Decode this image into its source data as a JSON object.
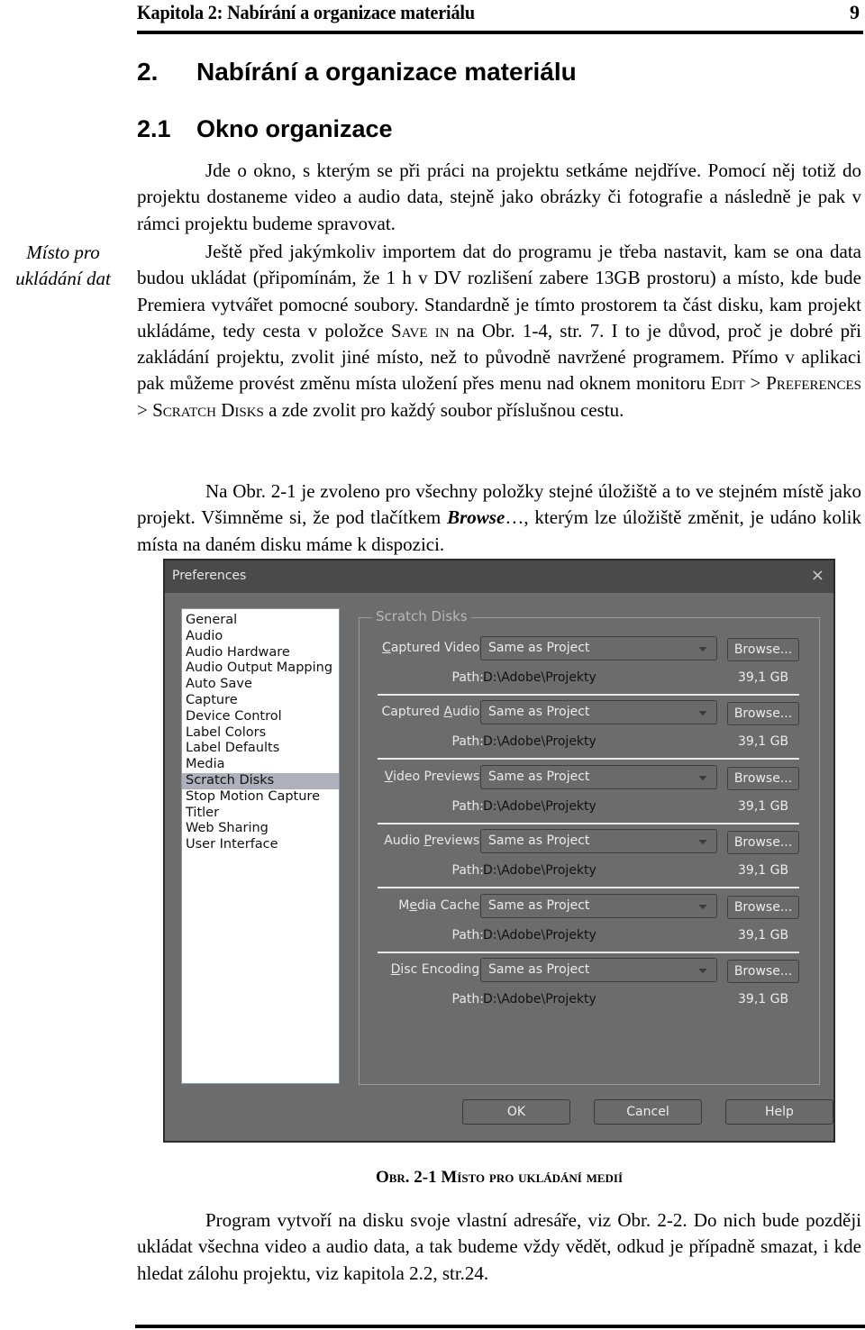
{
  "running_header": {
    "title": "Kapitola 2: Nabírání a organizace materiálu",
    "page_number": "9"
  },
  "chapter": {
    "number": "2.",
    "title": "Nabírání a organizace materiálu"
  },
  "section": {
    "number": "2.1",
    "title": "Okno organizace"
  },
  "margin_note": {
    "line1": "Místo pro",
    "line2": "ukládání dat"
  },
  "paragraphs": {
    "p1": "Jde o okno, s kterým se při práci na projektu setkáme nejdříve. Pomocí něj totiž do projektu dostaneme video a audio data, stejně jako obrázky či fotografie a následně je pak v rámci projektu budeme spravovat.",
    "p2_a": "Ještě před jakýmkoliv importem dat do programu je třeba nastavit, kam se ona data budou ukládat (připomínám, že 1 h v DV rozlišení zabere 13GB prostoru) a místo, kde bude Premiera vytvářet pomocné soubory. Standardně je tímto prostorem ta část disku, kam projekt ukládáme, tedy cesta v položce ",
    "p2_sc1": "Save in",
    "p2_b": " na Obr. 1-4, str. 7. I to je důvod, proč je dobré při zakládání projektu, zvolit jiné místo, než to původně navržené programem. Přímo v aplikaci pak můžeme provést změnu místa uložení přes menu nad oknem monitoru ",
    "p2_sc2": "Edit",
    "p2_c": " > ",
    "p2_sc3": "Preferences",
    "p2_d": " > ",
    "p2_sc4": "Scratch Disks",
    "p2_e": " a zde zvolit pro každý soubor příslušnou cestu.",
    "p3_a": "Na Obr. 2-1 je zvoleno pro všechny položky stejné úložiště a to ve stejném místě jako projekt. Všimněme si, že pod tlačítkem ",
    "p3_bold": "Browse",
    "p3_b": "…, kterým lze úložiště změnit, je udáno kolik místa na daném disku máme k dispozici.",
    "p4": "Program vytvoří na disku svoje vlastní adresáře, viz Obr. 2-2. Do nich bude později ukládat všechna video a audio data, a tak budeme vždy vědět, odkud je případně smazat, i kde hledat zálohu projektu, viz kapitola 2.2, str.24."
  },
  "figure_caption": "Obr. 2-1 Místo pro ukládání medií",
  "dialog": {
    "title": "Preferences",
    "close_icon": "×",
    "categories": [
      "General",
      "Audio",
      "Audio Hardware",
      "Audio Output Mapping",
      "Auto Save",
      "Capture",
      "Device Control",
      "Label Colors",
      "Label Defaults",
      "Media",
      "Scratch Disks",
      "Stop Motion Capture",
      "Titler",
      "Web Sharing",
      "User Interface"
    ],
    "selected_category": "Scratch Disks",
    "group_title": "Scratch Disks",
    "path_label": "Path:",
    "browse_label": "Browse...",
    "rows": [
      {
        "label_pre": "",
        "label_key": "C",
        "label_post": "aptured Video:",
        "value": "Same as Project",
        "path": "D:\\Adobe\\Projekty",
        "free": "39,1 GB"
      },
      {
        "label_pre": "Captured ",
        "label_key": "A",
        "label_post": "udio:",
        "value": "Same as Project",
        "path": "D:\\Adobe\\Projekty",
        "free": "39,1 GB"
      },
      {
        "label_pre": "",
        "label_key": "V",
        "label_post": "ideo Previews:",
        "value": "Same as Project",
        "path": "D:\\Adobe\\Projekty",
        "free": "39,1 GB"
      },
      {
        "label_pre": "Audio ",
        "label_key": "P",
        "label_post": "reviews:",
        "value": "Same as Project",
        "path": "D:\\Adobe\\Projekty",
        "free": "39,1 GB"
      },
      {
        "label_pre": "M",
        "label_key": "e",
        "label_post": "dia Cache:",
        "value": "Same as Project",
        "path": "D:\\Adobe\\Projekty",
        "free": "39,1 GB"
      },
      {
        "label_pre": "",
        "label_key": "D",
        "label_post": "isc Encoding:",
        "value": "Same as Project",
        "path": "D:\\Adobe\\Projekty",
        "free": "39,1 GB"
      }
    ],
    "buttons": {
      "ok": "OK",
      "cancel": "Cancel",
      "help": "Help"
    }
  }
}
